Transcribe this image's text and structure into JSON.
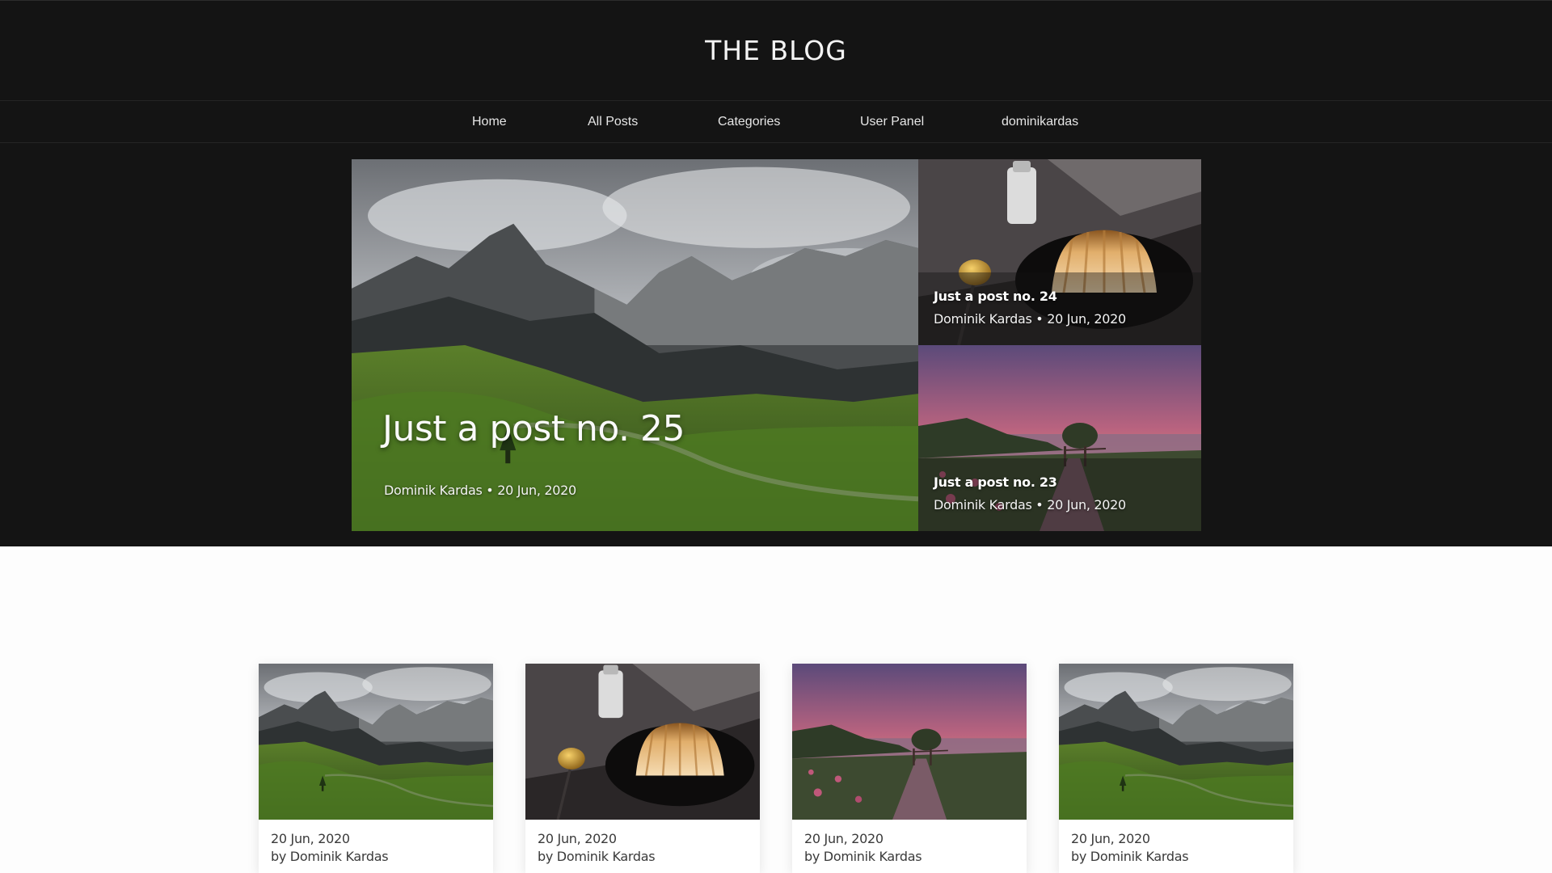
{
  "site": {
    "title": "THE BLOG"
  },
  "nav": {
    "items": [
      "Home",
      "All Posts",
      "Categories",
      "User Panel",
      "dominikardas"
    ]
  },
  "featured": {
    "main": {
      "title": "Just a post no. 25",
      "meta": "Dominik Kardas • 20 Jun, 2020",
      "image": "mountain-landscape"
    },
    "side": [
      {
        "title": "Just a post no. 24",
        "meta": "Dominik Kardas • 20 Jun, 2020",
        "image": "flan-dessert"
      },
      {
        "title": "Just a post no. 23",
        "meta": "Dominik Kardas • 20 Jun, 2020",
        "image": "sunset-boardwalk"
      }
    ]
  },
  "cards": [
    {
      "date": "20 Jun, 2020",
      "author": "by Dominik Kardas",
      "image": "mountain-landscape"
    },
    {
      "date": "20 Jun, 2020",
      "author": "by Dominik Kardas",
      "image": "flan-dessert"
    },
    {
      "date": "20 Jun, 2020",
      "author": "by Dominik Kardas",
      "image": "sunset-boardwalk"
    },
    {
      "date": "20 Jun, 2020",
      "author": "by Dominik Kardas",
      "image": "mountain-landscape"
    }
  ],
  "colors": {
    "header_bg": "#141414",
    "page_bg": "#fdfdfd",
    "text_light": "#f4f4f4"
  }
}
